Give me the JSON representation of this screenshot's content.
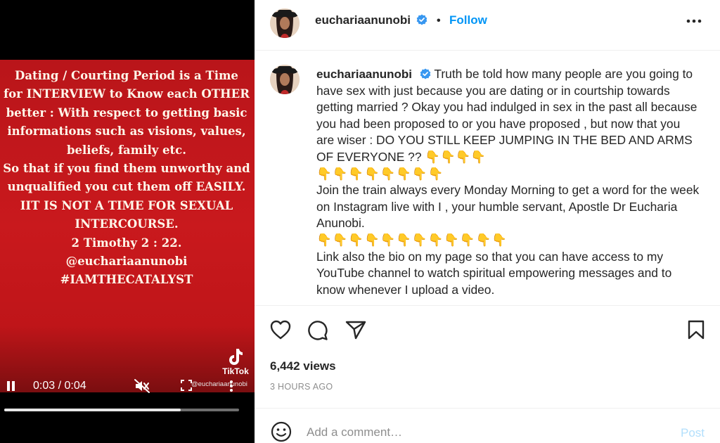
{
  "video": {
    "overlay_lines": [
      "Dating  / Courting  Period is a Time",
      "for INTERVIEW to Know each OTHER",
      "better  : With respect to getting basic",
      "informations such as visions,  values,",
      "beliefs, family etc.",
      "So that if you find them unworthy and",
      "unqualified you cut them off EASILY.",
      "IIT IS NOT A TIME FOR SEXUAL",
      "INTERCOURSE.",
      "2 Timothy 2 : 22.",
      "@euchariaanunobi",
      "#IAMTHECATALYST"
    ],
    "watermark_logo_label": "TikTok",
    "watermark_handle": "@euchariaanunobi",
    "time": "0:03 / 0:04",
    "progress": 0.75,
    "icons": {
      "play_pause": "pause-icon",
      "mute": "muted-speaker-icon",
      "fullscreen": "fullscreen-icon",
      "more": "more-vertical-icon"
    }
  },
  "header": {
    "username": "euchariaanunobi",
    "separator": "•",
    "follow_label": "Follow",
    "more_icon": "more-horizontal-icon"
  },
  "caption": {
    "username": "euchariaanunobi",
    "para1": "Truth be told how many people are you going to have sex with just because you are dating or in courtship towards getting married ? Okay you had indulged in sex in the past all because you had been proposed to or you have proposed , but now that you are wiser : DO YOU STILL KEEP JUMPING IN THE BED AND ARMS OF EVERYONE ??",
    "emoji_a": "👇👇👇👇",
    "emoji_b": "👇👇👇👇👇👇👇👇",
    "para2": "Join the train always every Monday  Morning to get a word for the week on  Instagram live  with I , your humble servant, Apostle Dr Eucharia Anunobi.",
    "emoji_c": "👇👇👇👇👇👇👇👇👇👇👇👇",
    "para3": "Link also the bio on my page so that you can have access to  my YouTube channel to watch spiritual empowering messages and to know whenever I upload a video."
  },
  "actions": {
    "icons": [
      "heart-icon",
      "comment-icon",
      "share-icon",
      "bookmark-icon"
    ]
  },
  "stats": {
    "views": "6,442 views",
    "time_ago": "3 HOURS AGO"
  },
  "comment": {
    "placeholder": "Add a comment…",
    "post_label": "Post"
  },
  "colors": {
    "accent": "#0095f6",
    "post_disabled": "#b2dffc",
    "video_red": "#c9191d",
    "verified": "#3897f0"
  }
}
